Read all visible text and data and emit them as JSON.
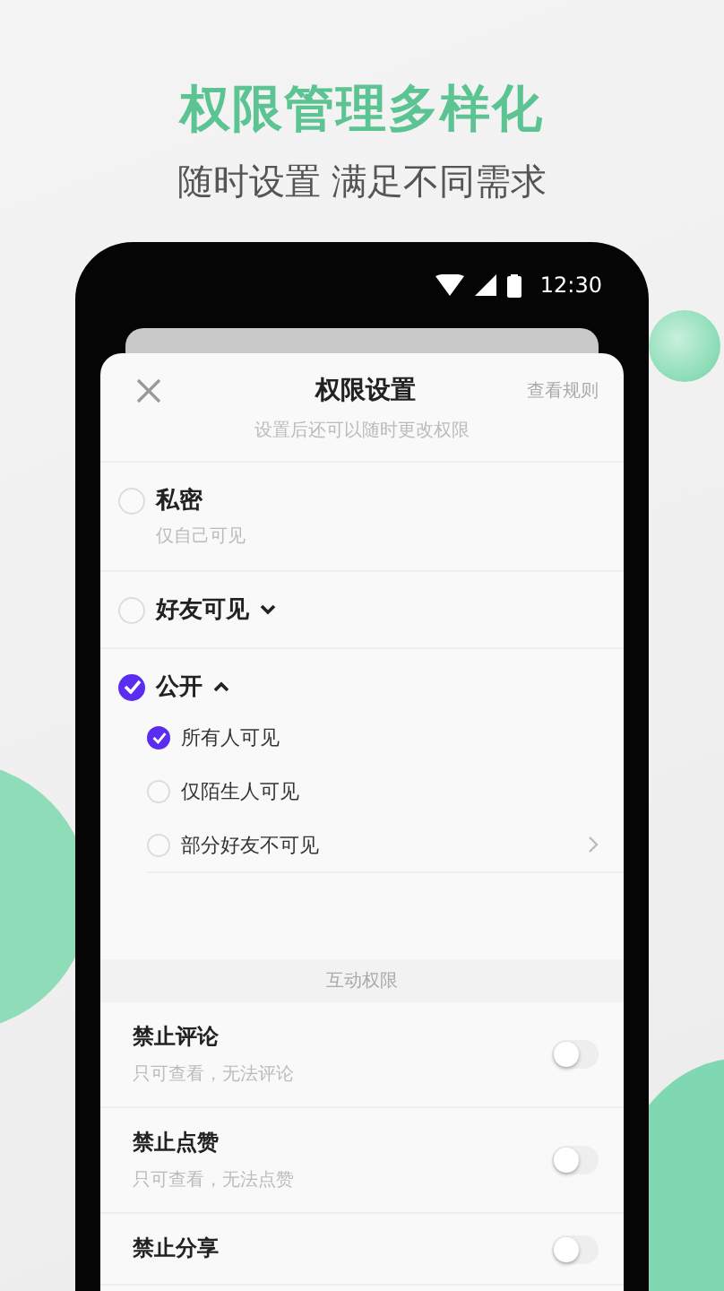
{
  "headline": "权限管理多样化",
  "subheadline": "随时设置 满足不同需求",
  "status_bar": {
    "time": "12:30"
  },
  "sheet": {
    "title": "权限设置",
    "action": "查看规则",
    "hint": "设置后还可以随时更改权限"
  },
  "visibility_options": [
    {
      "label": "私密",
      "description": "仅自己可见",
      "selected": false
    },
    {
      "label": "好友可见",
      "selected": false,
      "expanded": false
    },
    {
      "label": "公开",
      "selected": true,
      "expanded": true,
      "children": [
        {
          "label": "所有人可见",
          "selected": true,
          "has_arrow": false
        },
        {
          "label": "仅陌生人可见",
          "selected": false,
          "has_arrow": false
        },
        {
          "label": "部分好友不可见",
          "selected": false,
          "has_arrow": true
        }
      ]
    }
  ],
  "interaction_section": {
    "title": "互动权限",
    "items": [
      {
        "label": "禁止评论",
        "description": "只可查看，无法评论",
        "on": false
      },
      {
        "label": "禁止点赞",
        "description": "只可查看，无法点赞",
        "on": false
      },
      {
        "label": "禁止分享",
        "on": false
      }
    ]
  }
}
